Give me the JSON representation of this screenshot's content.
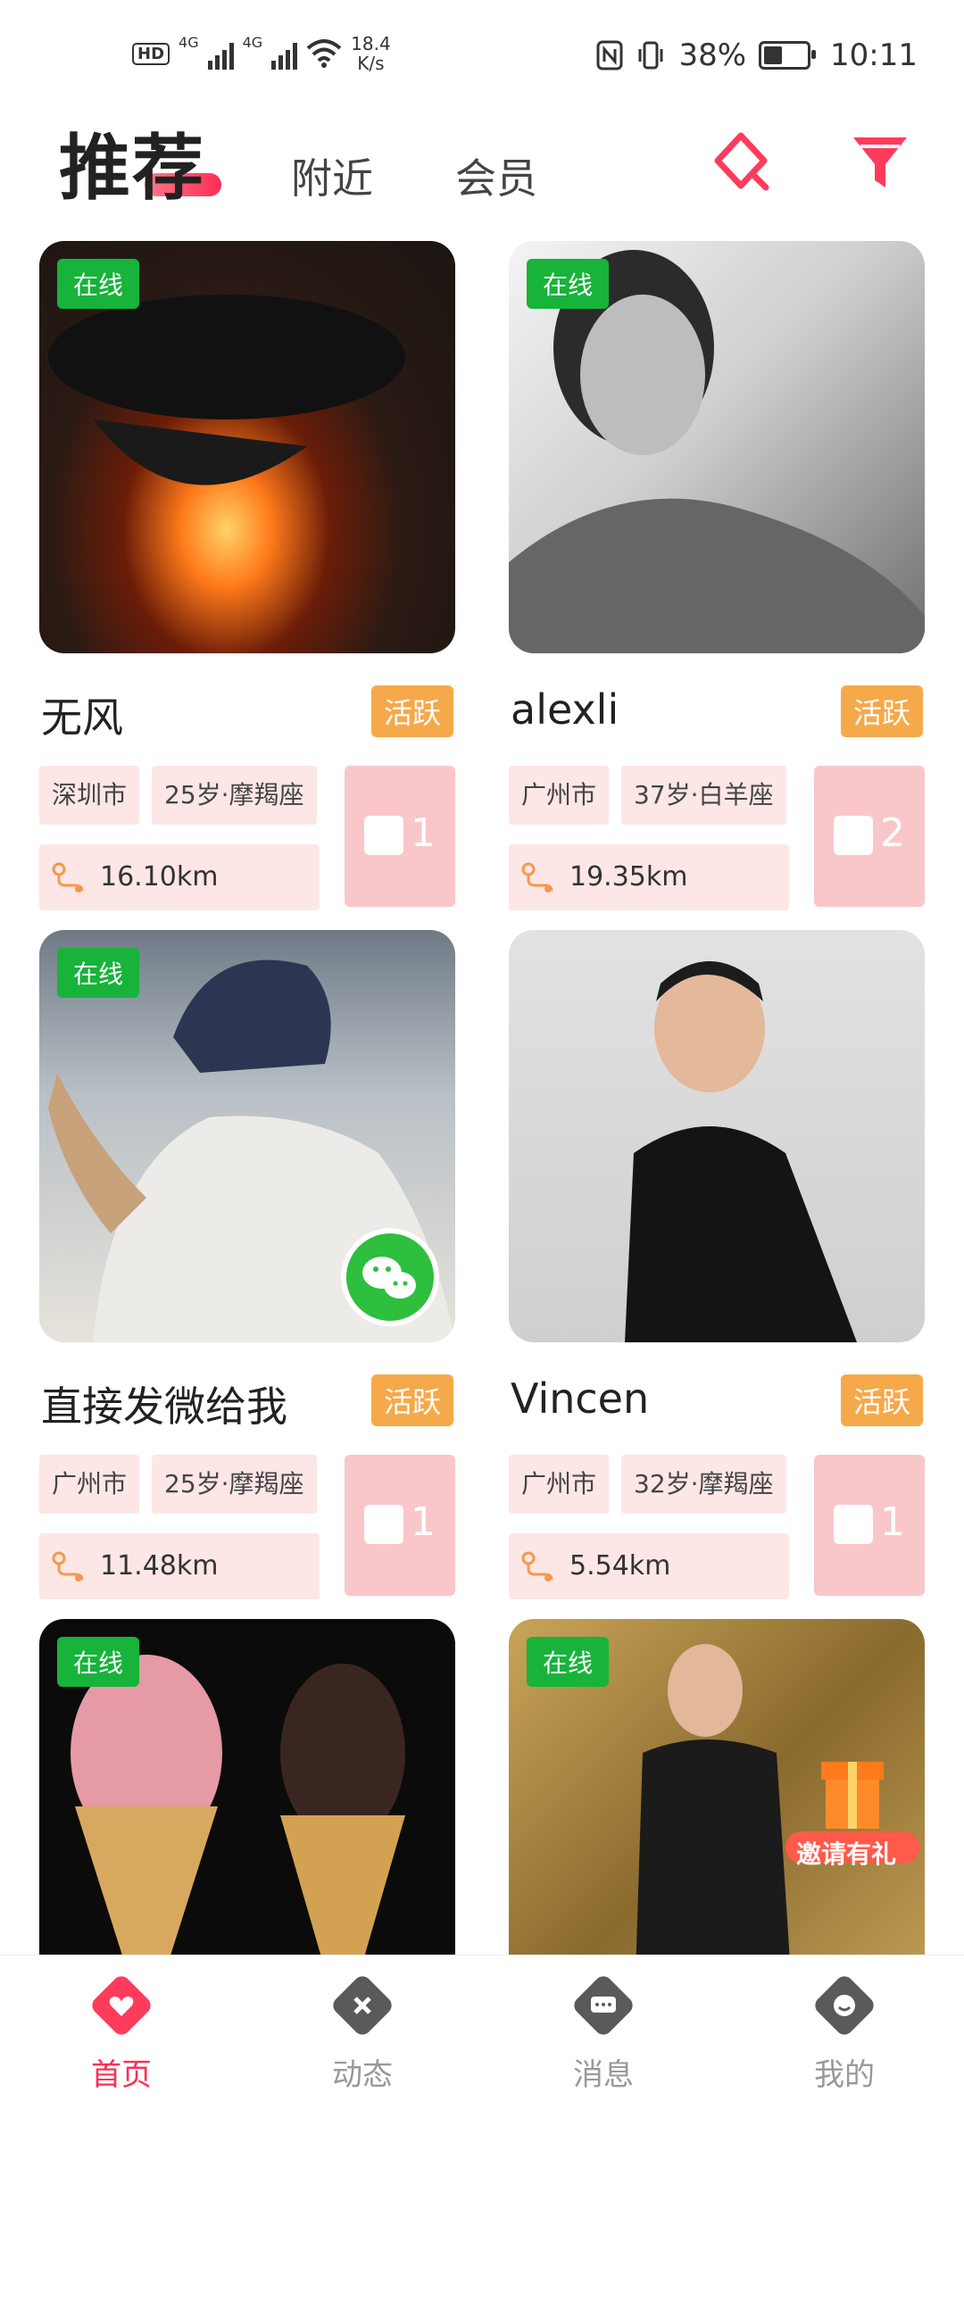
{
  "status_bar": {
    "hd": "HD",
    "sim1": "4G",
    "sim2": "4G",
    "net_speed_value": "18.4",
    "net_speed_unit": "K/s",
    "battery": "38%",
    "time": "10:11"
  },
  "header": {
    "tabs": [
      {
        "label": "推荐",
        "active": true
      },
      {
        "label": "附近",
        "active": false
      },
      {
        "label": "会员",
        "active": false
      }
    ],
    "icons": [
      "diamond-icon",
      "filter-icon"
    ],
    "accent": "#ff2d55"
  },
  "cards": [
    {
      "online": "在线",
      "name": "无风",
      "active": "活跃",
      "city": "深圳市",
      "age_sign": "25岁·摩羯座",
      "distance": "16.10km",
      "photos": "1",
      "wechat": false
    },
    {
      "online": "在线",
      "name": "alexli",
      "active": "活跃",
      "city": "广州市",
      "age_sign": "37岁·白羊座",
      "distance": "19.35km",
      "photos": "2",
      "wechat": false
    },
    {
      "online": "在线",
      "name": "直接发微给我",
      "active": "活跃",
      "city": "广州市",
      "age_sign": "25岁·摩羯座",
      "distance": "11.48km",
      "photos": "1",
      "wechat": true
    },
    {
      "online": "",
      "name": "Vincen",
      "active": "活跃",
      "city": "广州市",
      "age_sign": "32岁·摩羯座",
      "distance": "5.54km",
      "photos": "1",
      "wechat": false
    },
    {
      "online": "在线",
      "name": "",
      "active": "",
      "city": "",
      "age_sign": "",
      "distance": "",
      "photos": "",
      "wechat": true
    },
    {
      "online": "在线",
      "name": "",
      "active": "",
      "city": "",
      "age_sign": "",
      "distance": "",
      "photos": "",
      "wechat": true,
      "banner": "邀请有礼"
    }
  ],
  "bottom_nav": [
    {
      "label": "首页",
      "icon": "home-heart-icon",
      "active": true
    },
    {
      "label": "动态",
      "icon": "moments-icon",
      "active": false
    },
    {
      "label": "消息",
      "icon": "message-icon",
      "active": false
    },
    {
      "label": "我的",
      "icon": "profile-icon",
      "active": false
    }
  ]
}
